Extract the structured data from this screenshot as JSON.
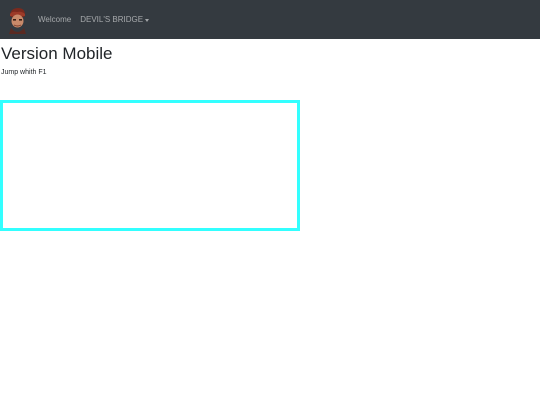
{
  "navbar": {
    "avatar_icon": "character-portrait-icon",
    "welcome_label": "Welcome",
    "dropdown_label": "DEVIL'S BRIDGE",
    "dropdown_icon": "caret-down-icon"
  },
  "main": {
    "title": "Version Mobile",
    "subtitle": "Jump whith F1"
  },
  "colors": {
    "navbar_bg": "#343a40",
    "canvas_border": "#33ffff"
  }
}
